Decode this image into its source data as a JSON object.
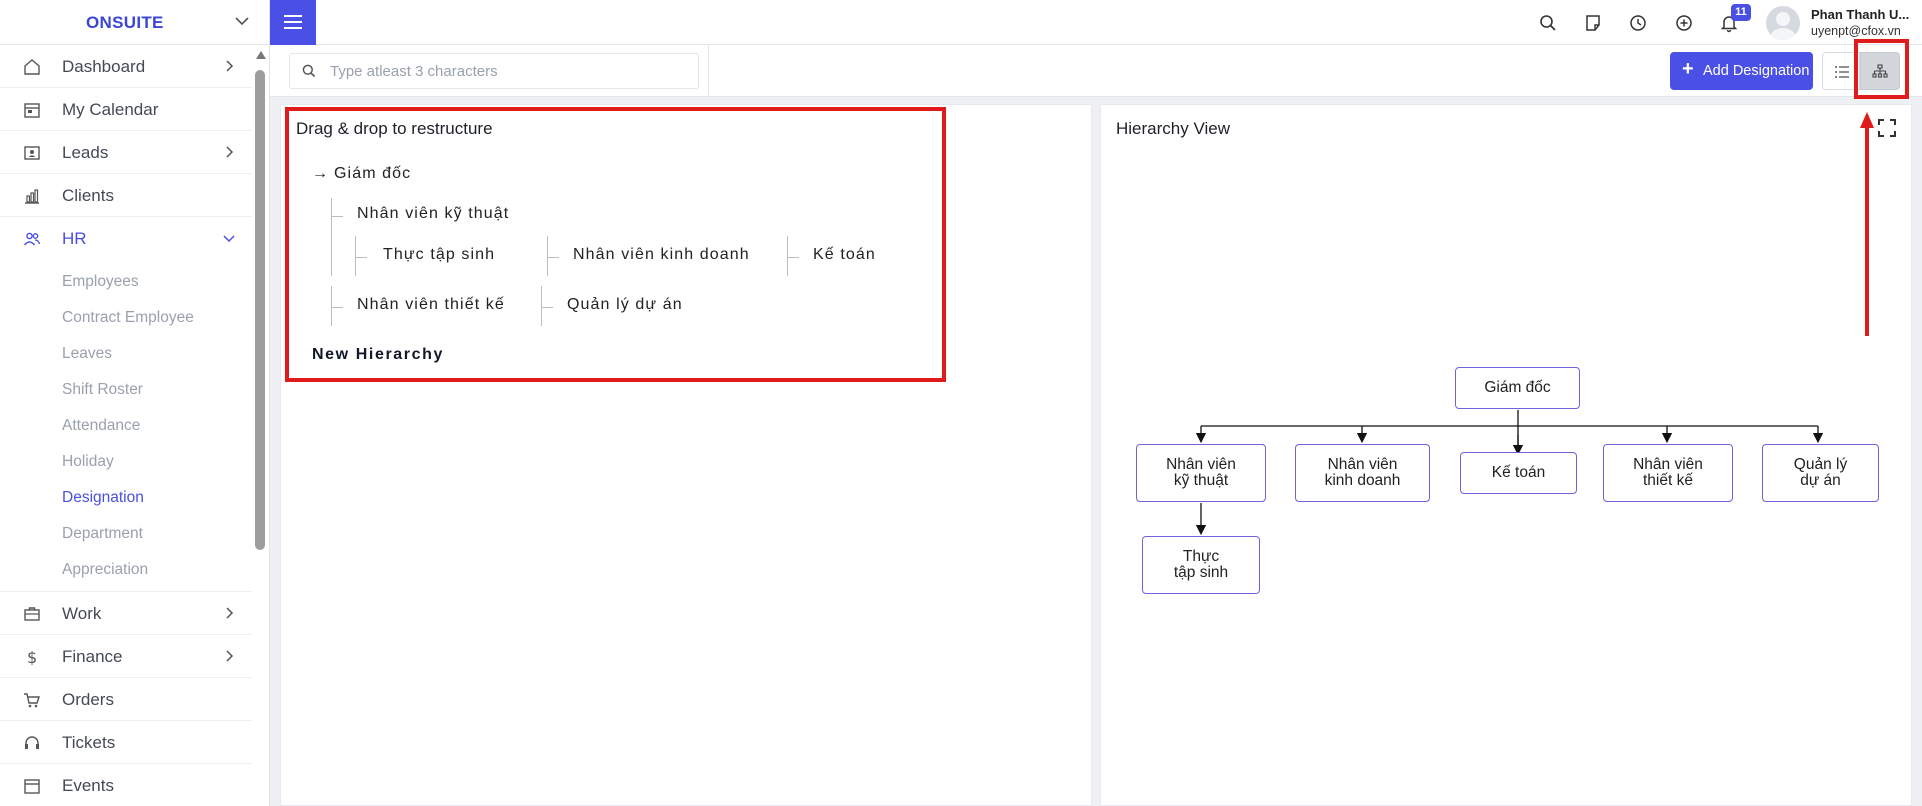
{
  "sidebar": {
    "brand": "ONSUITE",
    "items": [
      {
        "label": "Dashboard"
      },
      {
        "label": "My Calendar"
      },
      {
        "label": "Leads"
      },
      {
        "label": "Clients"
      },
      {
        "label": "HR"
      }
    ],
    "hr_sub": [
      {
        "label": "Employees"
      },
      {
        "label": "Contract Employee"
      },
      {
        "label": "Leaves"
      },
      {
        "label": "Shift Roster"
      },
      {
        "label": "Attendance"
      },
      {
        "label": "Holiday"
      },
      {
        "label": "Designation"
      },
      {
        "label": "Department"
      },
      {
        "label": "Appreciation"
      }
    ],
    "items_after": [
      {
        "label": "Work"
      },
      {
        "label": "Finance"
      },
      {
        "label": "Orders"
      },
      {
        "label": "Tickets"
      },
      {
        "label": "Events"
      }
    ]
  },
  "topbar": {
    "notification_count": "11",
    "user_name": "Phan Thanh U...",
    "user_email": "uyenpt@cfox.vn"
  },
  "toolbar": {
    "search_placeholder": "Type atleast 3 characters",
    "add_label": "Add Designation",
    "add_plus": "+"
  },
  "left_panel": {
    "title": "Drag & drop to restructure",
    "tree": {
      "root": "Giám đốc",
      "arrow": "→",
      "n1": "Nhân viên kỹ thuật",
      "n1_child": "Thực tập sinh",
      "n2": "Nhân viên kinh doanh",
      "n3": "Kế toán",
      "n4": "Nhân viên thiết kế",
      "n5": "Quản lý dự án"
    },
    "new_hierarchy": "New Hierarchy"
  },
  "right_panel": {
    "title": "Hierarchy View",
    "org": {
      "root": "Giám đốc",
      "c1a": "Nhân viên",
      "c1b": "kỹ thuật",
      "c2a": "Nhân viên",
      "c2b": "kinh doanh",
      "c3": "Kế toán",
      "c4a": "Nhân viên",
      "c4b": "thiết kế",
      "c5a": "Quản lý",
      "c5b": "dự án",
      "g1a": "Thực",
      "g1b": "tập sinh"
    }
  },
  "colors": {
    "accent": "#4a4fe5",
    "annotation": "#e01b1b",
    "node_border": "#6d63dd"
  }
}
